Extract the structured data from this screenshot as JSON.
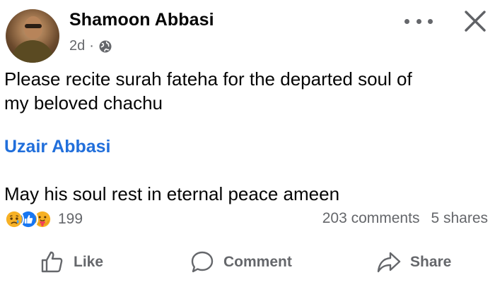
{
  "post": {
    "author": "Shamoon Abbasi",
    "time": "2d",
    "separator": "·",
    "audience_icon": "globe-icon",
    "line1": "Please recite surah fateha for the departed soul of",
    "line2": "my beloved chachu",
    "mention": "Uzair Abbasi",
    "line3": "May his soul rest in eternal peace ameen"
  },
  "reactions": {
    "icons": [
      "sad-reaction-icon",
      "like-reaction-icon",
      "care-reaction-icon"
    ],
    "count": "199"
  },
  "stats": {
    "comments": "203 comments",
    "shares": "5 shares"
  },
  "actions": {
    "like": "Like",
    "comment": "Comment",
    "share": "Share"
  },
  "colors": {
    "text": "#050505",
    "secondary": "#65676b",
    "mention": "#216fdb",
    "like_blue": "#1877f2",
    "sad_yellow": "#f7b125",
    "care_red": "#f33e58"
  }
}
